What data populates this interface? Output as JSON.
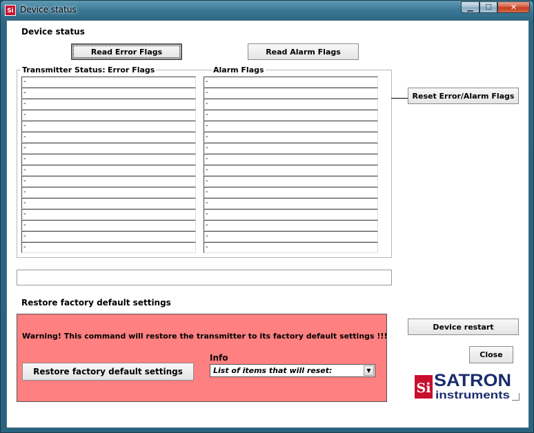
{
  "window": {
    "title": "Device status",
    "app_icon_text": "Si",
    "minimize_glyph": "▁",
    "maximize_glyph": "☐",
    "close_glyph": "✕"
  },
  "device_status": {
    "heading": "Device status",
    "read_error_label": "Read Error Flags",
    "read_alarm_label": "Read Alarm Flags",
    "reset_flags_label": "Reset Error/Alarm Flags",
    "transmitter_status_label": "Transmitter Status:",
    "error_flags_label": "Error Flags",
    "alarm_flags_label": "Alarm Flags",
    "error_flags": [
      "-",
      "-",
      "-",
      "-",
      "-",
      "-",
      "-",
      "-",
      "-",
      "-",
      "-",
      "-",
      "-",
      "-",
      "-",
      "-"
    ],
    "alarm_flags": [
      "-",
      "-",
      "-",
      "-",
      "-",
      "-",
      "-",
      "-",
      "-",
      "-",
      "-",
      "-",
      "-",
      "-",
      "-",
      "-"
    ],
    "status_text": ""
  },
  "factory_reset": {
    "heading": "Restore factory default settings",
    "warning_text": "Warning! This command will restore the transmitter to its factory default settings !!!",
    "restore_button_label": "Restore factory default settings",
    "info_label": "Info",
    "info_selected": "List of items that will reset:"
  },
  "actions": {
    "device_restart_label": "Device restart",
    "close_label": "Close"
  },
  "logo": {
    "brand": "SATRON",
    "sub": "instruments",
    "mark": "Si",
    "red": "#c8102e",
    "navy": "#1a2b6d"
  }
}
